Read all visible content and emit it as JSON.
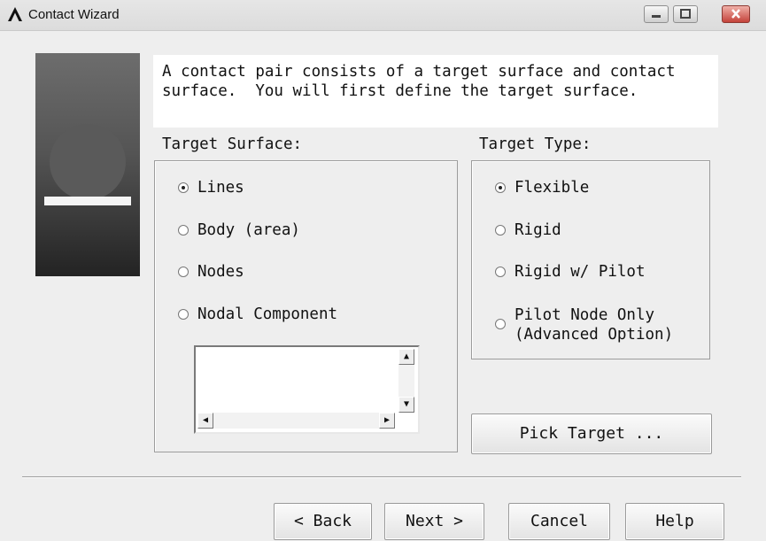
{
  "window": {
    "title": "Contact Wizard",
    "logo": "ansys-lambda-logo",
    "controls": [
      "minimize-icon",
      "maximize-icon",
      "close-icon"
    ]
  },
  "instructions": "A contact pair consists of a target surface and contact\nsurface.  You will first define the target surface.",
  "target_surface": {
    "label": "Target Surface:",
    "options": [
      {
        "label": "Lines",
        "selected": true
      },
      {
        "label": "Body (area)",
        "selected": false
      },
      {
        "label": "Nodes",
        "selected": false
      },
      {
        "label": "Nodal Component",
        "selected": false
      }
    ]
  },
  "target_type": {
    "label": "Target Type:",
    "options": [
      {
        "label": "Flexible",
        "selected": true
      },
      {
        "label": "Rigid",
        "selected": false
      },
      {
        "label": "Rigid w/ Pilot",
        "selected": false
      },
      {
        "label_line1": "Pilot Node Only",
        "label_line2": "(Advanced Option)",
        "selected": false
      }
    ]
  },
  "buttons": {
    "pick_target": "Pick Target ...",
    "back": "< Back",
    "next": "Next >",
    "cancel": "Cancel",
    "help": "Help"
  }
}
